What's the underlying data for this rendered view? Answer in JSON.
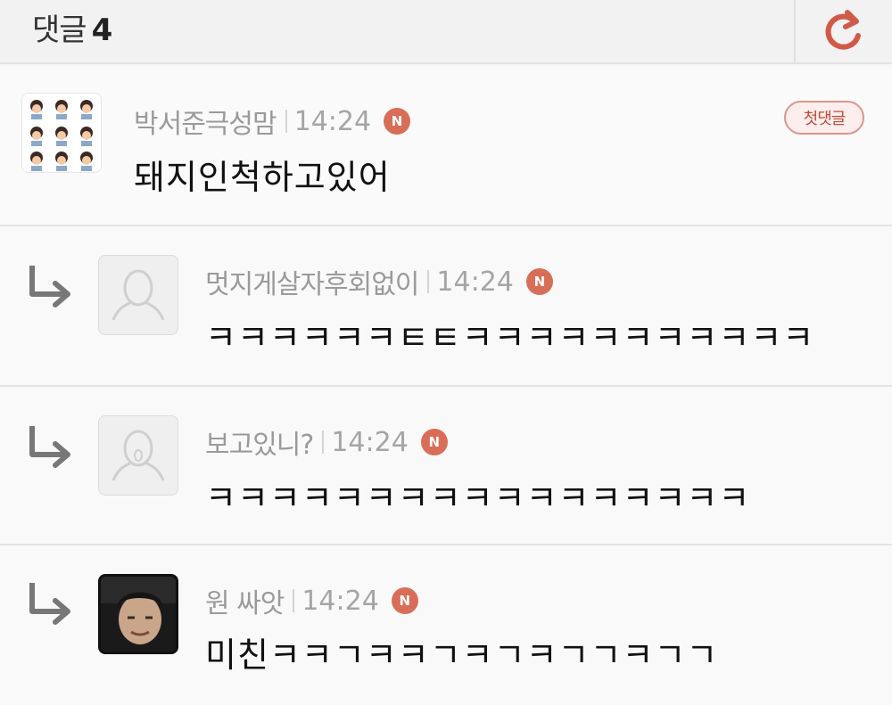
{
  "header": {
    "title": "댓글",
    "count": "4"
  },
  "comments": [
    {
      "author": "박서준극성맘",
      "time": "14:24",
      "badge": "N",
      "tag": "첫댓글",
      "text": "돼지인척하고있어"
    },
    {
      "author": "멋지게살자후회없이",
      "time": "14:24",
      "badge": "N",
      "text": "ㅋㅋㅋㅋㅋㅋㅌㅌㅋㅋㅋㅋㅋㅋㅋㅋㅋㅋㅋ"
    },
    {
      "author": "보고있니?",
      "time": "14:24",
      "badge": "N",
      "text": "ㅋㅋㅋㅋㅋㅋㅋㅋㅋㅋㅋㅋㅋㅋㅋㅋㅋ"
    },
    {
      "author": "원 싸앗",
      "time": "14:24",
      "badge": "N",
      "text": "미친ㅋㅋㄱㅋㅋㄱㅋㄱㅋㄱㄱㅋㄱㄱ"
    }
  ],
  "colors": {
    "accent": "#d86e58",
    "meta_text": "#9a9a9a"
  },
  "icons": {
    "refresh": "refresh-icon",
    "reply": "reply-arrow-icon",
    "new": "new-badge-icon"
  }
}
